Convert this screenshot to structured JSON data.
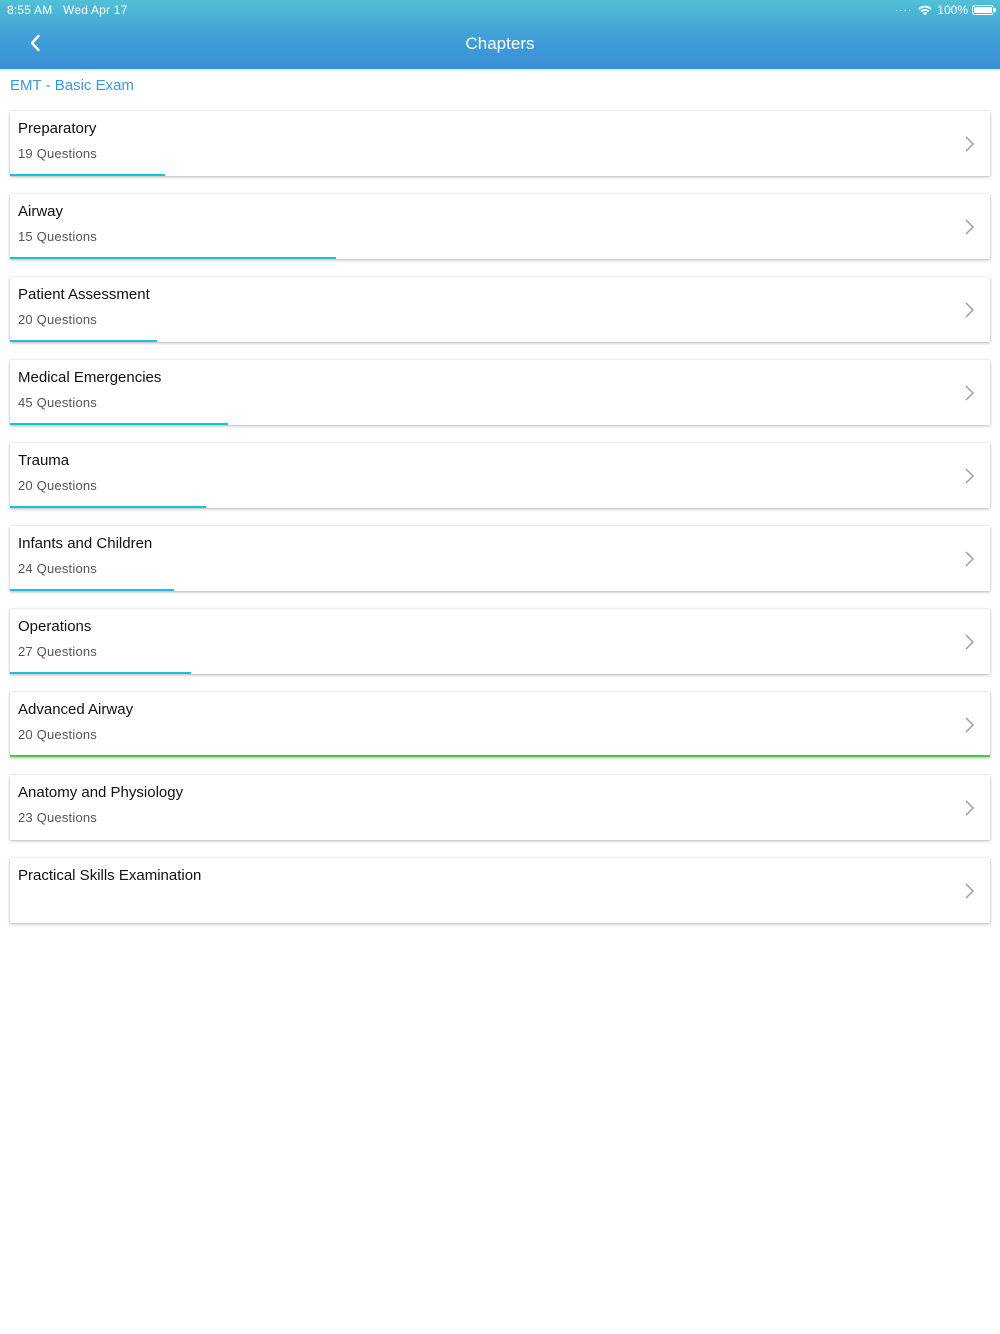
{
  "status_bar": {
    "time": "8:55 AM",
    "date": "Wed Apr 17",
    "battery": "100%"
  },
  "header": {
    "title": "Chapters",
    "back_icon": "chevron-left-icon",
    "gradient_top": "#52c0d6",
    "gradient_bottom": "#3a8fd5"
  },
  "breadcrumb": "EMT - Basic Exam",
  "colors": {
    "progress": "#1dbfdf",
    "progress_complete": "#4cc84a",
    "breadcrumb": "#3a9ad9"
  },
  "chapters": [
    {
      "title": "Preparatory",
      "count": "19 Questions",
      "progress": 0.158,
      "complete": false
    },
    {
      "title": "Airway",
      "count": "15 Questions",
      "progress": 0.333,
      "complete": false
    },
    {
      "title": "Patient Assessment",
      "count": "20 Questions",
      "progress": 0.15,
      "complete": false
    },
    {
      "title": "Medical Emergencies",
      "count": "45 Questions",
      "progress": 0.222,
      "complete": false
    },
    {
      "title": "Trauma",
      "count": "20 Questions",
      "progress": 0.2,
      "complete": false
    },
    {
      "title": "Infants and Children",
      "count": "24 Questions",
      "progress": 0.167,
      "complete": false
    },
    {
      "title": "Operations",
      "count": "27 Questions",
      "progress": 0.185,
      "complete": false
    },
    {
      "title": "Advanced Airway",
      "count": "20 Questions",
      "progress": 1.0,
      "complete": true
    },
    {
      "title": "Anatomy and Physiology",
      "count": "23 Questions",
      "progress": 0,
      "complete": false
    },
    {
      "title": "Practical Skills Examination",
      "count": "",
      "progress": 0,
      "complete": false
    }
  ]
}
